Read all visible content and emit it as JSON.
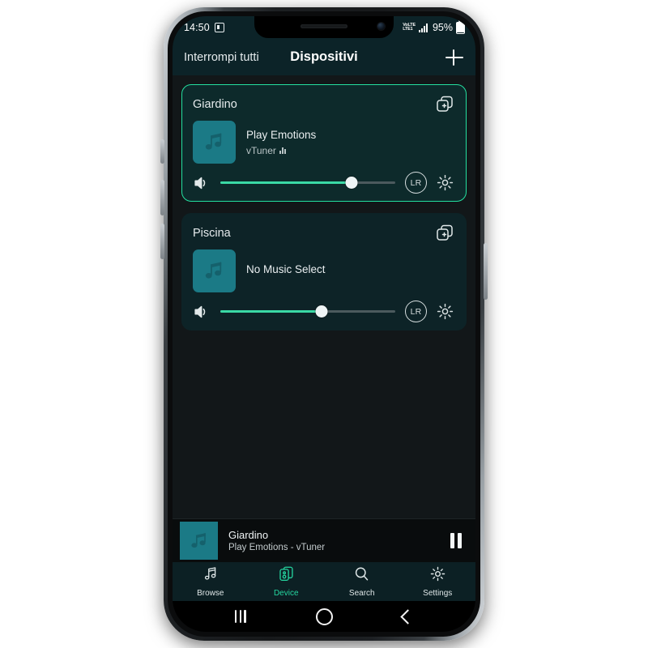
{
  "statusbar": {
    "clock": "14:50",
    "app_icon": "screen-recorder-icon",
    "network_line1": "VoLTE",
    "network_line2": "LTE1",
    "battery_percent": "95%"
  },
  "appbar": {
    "left_action": "Interrompi tutti",
    "title": "Dispositivi",
    "add_icon": "plus-icon"
  },
  "devices": [
    {
      "name": "Giardino",
      "active": true,
      "group_icon": "add-to-group-icon",
      "art_icon": "music-note-icon",
      "track_title": "Play Emotions",
      "source": "vTuner",
      "source_icon": "equalizer-bars-icon",
      "volume_percent": 75,
      "volume_icon": "speaker-icon",
      "balance_label": "LR",
      "settings_icon": "gear-icon"
    },
    {
      "name": "Piscina",
      "active": false,
      "group_icon": "add-to-group-icon",
      "art_icon": "music-note-icon",
      "track_title": "No Music Select",
      "source": "",
      "source_icon": "",
      "volume_percent": 58,
      "volume_icon": "speaker-icon",
      "balance_label": "LR",
      "settings_icon": "gear-icon"
    }
  ],
  "nowplaying": {
    "art_icon": "music-note-icon",
    "device": "Giardino",
    "track": "Play Emotions - vTuner",
    "transport_icon": "pause-icon"
  },
  "tabs": [
    {
      "label": "Browse",
      "icon": "music-notes-icon",
      "active": false
    },
    {
      "label": "Device",
      "icon": "device-stack-icon",
      "active": true
    },
    {
      "label": "Search",
      "icon": "search-icon",
      "active": false
    },
    {
      "label": "Settings",
      "icon": "gear-icon",
      "active": false
    }
  ],
  "navbar": {
    "recents": "recents-icon",
    "home": "home-icon",
    "back": "back-icon"
  },
  "colors": {
    "accent": "#25d6a0",
    "card": "#0d2327",
    "card_active_border": "#24e0a0",
    "appbar": "#0c2328",
    "background": "#121719",
    "art": "#1b7a86"
  }
}
